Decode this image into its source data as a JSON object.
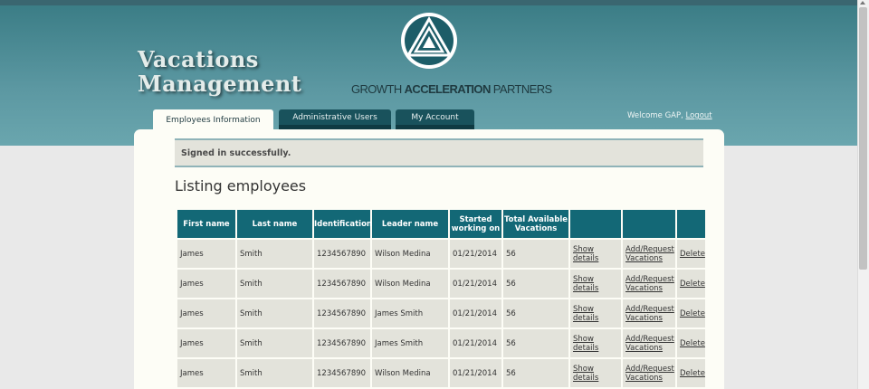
{
  "header": {
    "app_title_line1": "Vacations",
    "app_title_line2": "Management",
    "logo_text_1": "GROWTH ",
    "logo_text_2": "ACCELERATION",
    "logo_text_3": " PARTNERS"
  },
  "tabs": [
    {
      "label": "Employees Information",
      "active": true
    },
    {
      "label": "Administrative Users",
      "active": false
    },
    {
      "label": "My Account",
      "active": false
    }
  ],
  "user": {
    "welcome": "Welcome GAP,",
    "logout": "Logout"
  },
  "notice": "Signed in successfully.",
  "page_title": "Listing employees",
  "table": {
    "headers": [
      "First name",
      "Last name",
      "Identification",
      "Leader name",
      "Started working on",
      "Total Available Vacations",
      "",
      "",
      ""
    ],
    "rows": [
      [
        "James",
        "Smith",
        "1234567890",
        "Wilson Medina",
        "01/21/2014",
        "56",
        "Show details",
        "Add/Request Vacations",
        "Delete"
      ],
      [
        "James",
        "Smith",
        "1234567890",
        "Wilson Medina",
        "01/21/2014",
        "56",
        "Show details",
        "Add/Request Vacations",
        "Delete"
      ],
      [
        "James",
        "Smith",
        "1234567890",
        "James Smith",
        "01/21/2014",
        "56",
        "Show details",
        "Add/Request Vacations",
        "Delete"
      ],
      [
        "James",
        "Smith",
        "1234567890",
        "James Smith",
        "01/21/2014",
        "56",
        "Show details",
        "Add/Request Vacations",
        "Delete"
      ],
      [
        "James",
        "Smith",
        "1234567890",
        "Wilson Medina",
        "01/21/2014",
        "56",
        "Show details",
        "Add/Request Vacations",
        "Delete"
      ]
    ]
  },
  "colors": {
    "header": "#4a8a94",
    "tab_inactive": "#19525c",
    "table_header": "#136876",
    "cell": "#e3e3db"
  },
  "icons": {
    "logo": "triangle-logo-icon"
  }
}
